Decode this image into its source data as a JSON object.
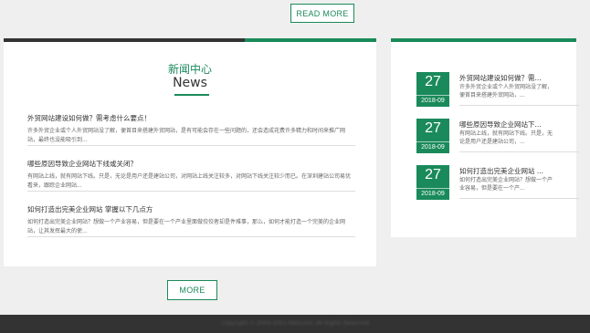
{
  "top": {
    "read_more_label": "READ MORE"
  },
  "news": {
    "heading_cn": "新闻中心",
    "heading_en": "News",
    "items": [
      {
        "title": "外贸网站建设如何做？需考虑什么要点！",
        "desc": "许多外贸企业或个人外贸网站没了解，便首目来搭建外贸网站，是有可能会存在一些问题的，还会造成花费许多精力和时间来推广网站，最终也没能吸引到..."
      },
      {
        "title": "哪些原因导致企业网站下线或关闭？",
        "desc": "有网站上线，就有网站下线。只是，无论是用户还是建站公司，对网站上线关注较多，对网站下线关注较少而已。在深圳建站公司易优看来，跟踪企业网站..."
      },
      {
        "title": "如何打造出完美企业网站 掌握以下几点方",
        "desc": "如何打造出完美企业网站？想做一个产业容易，但是要在一个产业里面做佼佼者却是件难事，那么，如何才能打造一个完美的企业网站，让其发挥最大的使..."
      }
    ],
    "more_label": "MORE"
  },
  "dated": {
    "items": [
      {
        "day": "27",
        "ym": "2018-09",
        "title": "外贸网站建设如何做？需...",
        "desc": "许多外贸企业或个人外贸网站没了解，便首目来搭建外贸网站，..."
      },
      {
        "day": "27",
        "ym": "2018-09",
        "title": "哪些原因导致企业网站下...",
        "desc": "有网站上线，就有网站下线。只是，无论是用户还是建站公司，..."
      },
      {
        "day": "27",
        "ym": "2018-09",
        "title": "如何打造出完美企业网站 ...",
        "desc": "如何打造出完美企业网站？想做一个产业容易，但是要在一个产..."
      }
    ]
  },
  "footer": {
    "copyright": "Copyright © 2004-2021 ENGLISH, All Rights Reserved"
  }
}
